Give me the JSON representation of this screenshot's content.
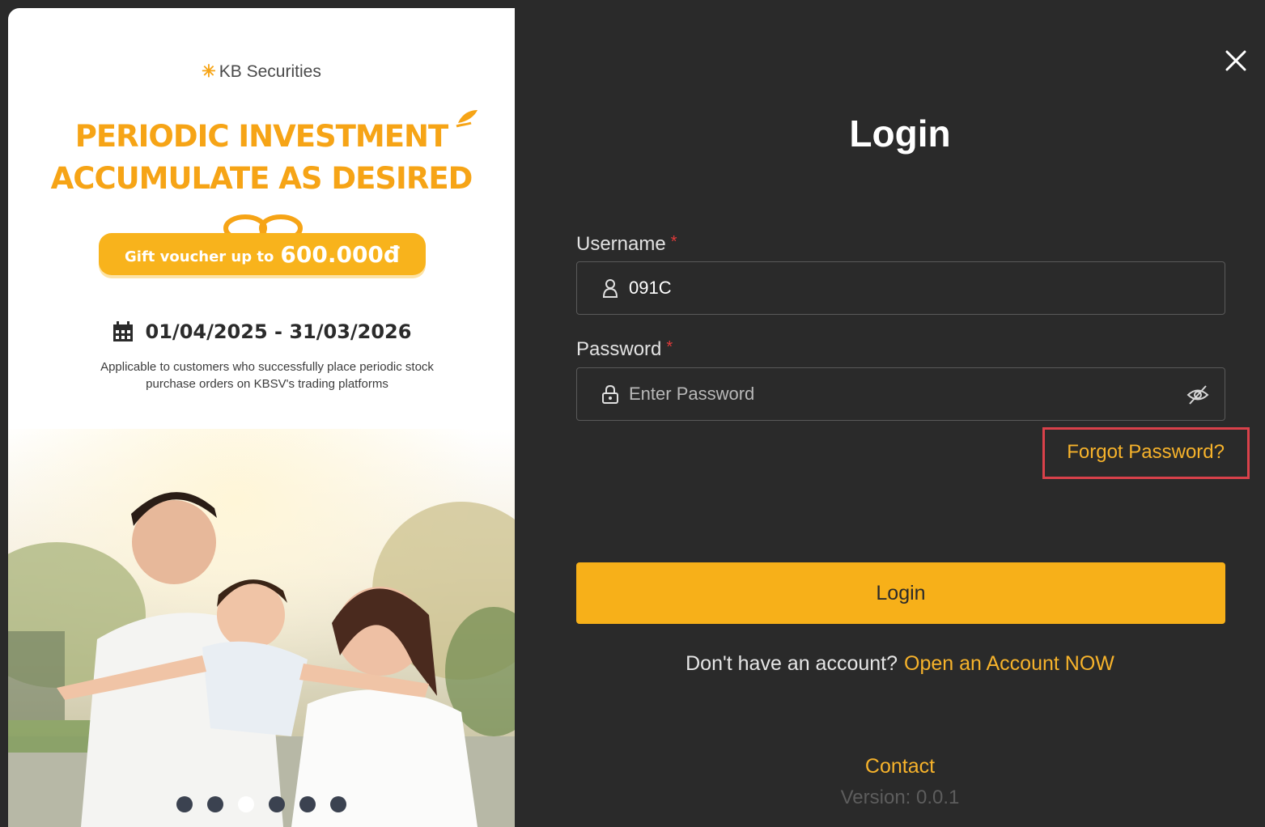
{
  "banner": {
    "brand": "KB Securities",
    "headline_1": "PERIODIC INVESTMENT",
    "headline_2": "ACCUMULATE AS DESIRED",
    "voucher_text": "Gift voucher up to",
    "voucher_amount": "600.000đ",
    "dates": "01/04/2025 - 31/03/2026",
    "applicable_line_1": "Applicable to customers who successfully place periodic stock",
    "applicable_line_2": "purchase orders on KBSV's trading platforms",
    "carousel": {
      "count": 6,
      "active_index": 2
    }
  },
  "login": {
    "title": "Login",
    "username_label": "Username",
    "username_value": "091C",
    "password_label": "Password",
    "password_placeholder": "Enter Password",
    "required_mark": "*",
    "forgot_password": "Forgot Password?",
    "login_button": "Login",
    "no_account_text": "Don't have an account?",
    "open_account_link": "Open an Account NOW",
    "contact": "Contact",
    "version": "Version: 0.0.1"
  },
  "colors": {
    "accent": "#f7b019",
    "panel_background": "#2a2a2a",
    "highlight_box": "#d9414a"
  },
  "icons": {
    "close": "close-icon",
    "user": "user-icon",
    "lock": "lock-icon",
    "eye_off": "eye-off-icon",
    "calendar": "calendar-icon"
  }
}
